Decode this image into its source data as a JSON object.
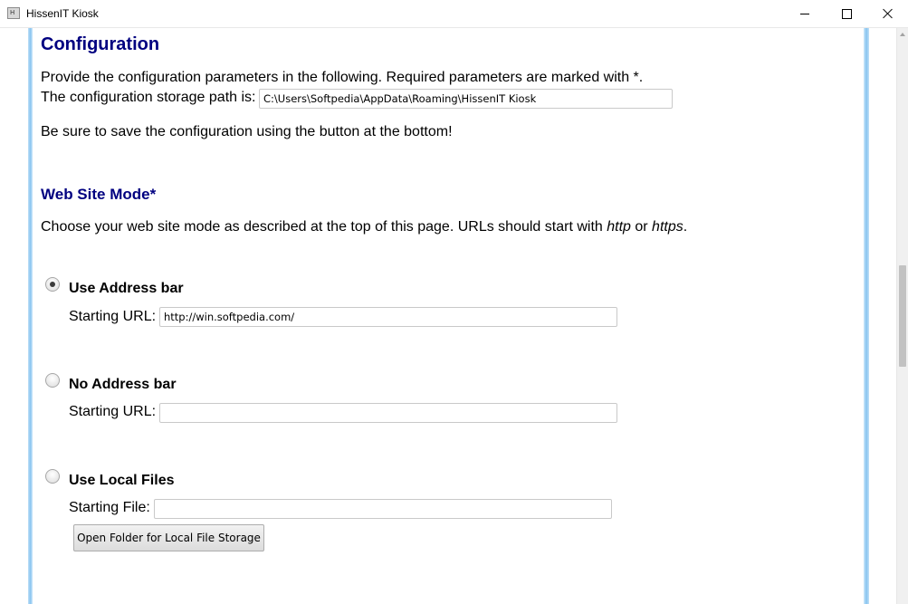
{
  "window": {
    "title": "HissenIT Kiosk",
    "icon_letter": "H"
  },
  "page": {
    "heading": "Configuration",
    "intro_line": "Provide the configuration parameters in the following. Required parameters are marked with *.",
    "storage_path_label": "The configuration storage path is:",
    "storage_path_value": "C:\\Users\\Softpedia\\AppData\\Roaming\\HissenIT Kiosk",
    "save_reminder": "Be sure to save the configuration using the button at the bottom!",
    "mode_heading": "Web Site Mode*",
    "mode_description_prefix": "Choose your web site mode as described at the top of this page. URLs should start with ",
    "mode_description_http": "http",
    "mode_description_or": " or ",
    "mode_description_https": "https",
    "mode_description_suffix": ".",
    "options": [
      {
        "label": "Use Address bar",
        "checked": true,
        "field_label": "Starting URL:",
        "field_value": "http://win.softpedia.com/"
      },
      {
        "label": "No Address bar",
        "checked": false,
        "field_label": "Starting URL:",
        "field_value": ""
      },
      {
        "label": "Use Local Files",
        "checked": false,
        "field_label": "Starting File:",
        "field_value": ""
      }
    ],
    "open_folder_button": "Open Folder for Local File Storage"
  },
  "colors": {
    "heading": "#000080",
    "side_border": "#87c4ef"
  },
  "icons": [
    "app-icon",
    "minimize-icon",
    "maximize-icon",
    "close-icon",
    "scroll-up-arrow-icon"
  ]
}
